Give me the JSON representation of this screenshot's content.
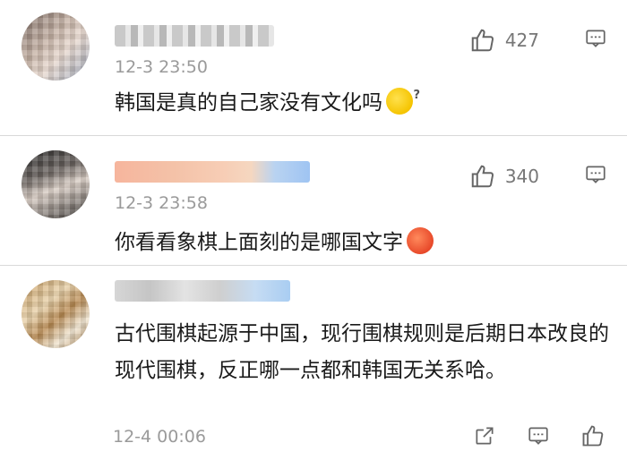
{
  "comments": [
    {
      "time": "12-3 23:50",
      "text": "韩国是真的自己家没有文化吗",
      "likes": "427",
      "emoji": "sweat-smile-icon"
    },
    {
      "time": "12-3 23:58",
      "text": "你看看象棋上面刻的是哪国文字",
      "likes": "340",
      "emoji": "angry-face-icon"
    },
    {
      "time": "12-4 00:06",
      "text": "古代围棋起源于中国，现行围棋规则是后期日本改良的现代围棋，反正哪一点都和韩国无关系哈。"
    }
  ]
}
